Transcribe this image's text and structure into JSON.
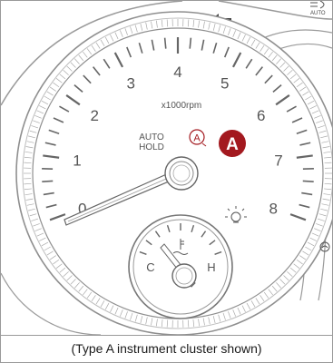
{
  "tachometer": {
    "unit": "x1000rpm",
    "labels": [
      "0",
      "1",
      "2",
      "3",
      "4",
      "5",
      "6",
      "7",
      "8"
    ]
  },
  "auto_hold": {
    "line1": "AUTO",
    "line2": "HOLD",
    "glyph": "A"
  },
  "callout": {
    "letter": "A",
    "color": "#a3191f"
  },
  "temp_gauge": {
    "cold": "C",
    "hot": "H"
  },
  "top_right": {
    "label": "AUTO"
  },
  "icons": [
    "turn-signal-left-icon",
    "coolant-temperature-icon",
    "headlamp-bulb-icon",
    "auto-light-icon",
    "engine-warning-icon"
  ],
  "caption": "(Type A instrument cluster shown)"
}
